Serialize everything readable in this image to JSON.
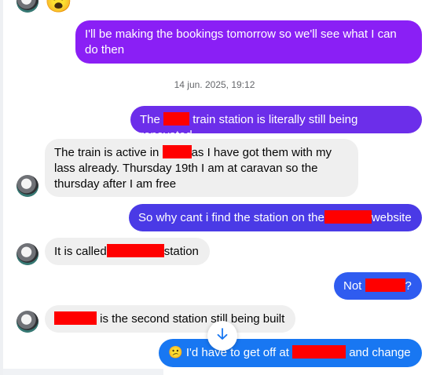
{
  "conversation": {
    "top_reaction_emoji": "😮",
    "timestamp": "14 jun. 2025, 19:12",
    "messages": [
      {
        "id": "m1",
        "direction": "out",
        "text": "I'll be making the bookings tomorrow so we'll see what I can do then"
      },
      {
        "id": "m2",
        "direction": "out",
        "before": "The",
        "after": "train station is literally still being renovated"
      },
      {
        "id": "m3",
        "direction": "in",
        "before": "The train is active in",
        "after": "as I have got them with my lass already. Thursday 19th I am at caravan so the thursday after I am free"
      },
      {
        "id": "m4",
        "direction": "out",
        "before": "So why cant i find the station on the",
        "after": "website"
      },
      {
        "id": "m5",
        "direction": "in",
        "before": "It is called",
        "after": "station"
      },
      {
        "id": "m6",
        "direction": "out",
        "before": "Not",
        "after": "?"
      },
      {
        "id": "m7",
        "direction": "in",
        "before": "",
        "after": "is the second station still being built"
      },
      {
        "id": "m8",
        "direction": "out",
        "emoji": "😕",
        "before": "I'd have to get off at",
        "after": "and change"
      }
    ]
  },
  "colors": {
    "bubble_purple": "#8a1ff5",
    "bubble_violet": "#6c2eea",
    "bubble_indigo": "#4a3ae6",
    "bubble_blue": "#2f5cf0",
    "bubble_bright": "#1877f2",
    "bubble_incoming": "#efefef",
    "redaction": "#ff0000"
  },
  "icons": {
    "scroll_down": "arrow-down-icon"
  }
}
